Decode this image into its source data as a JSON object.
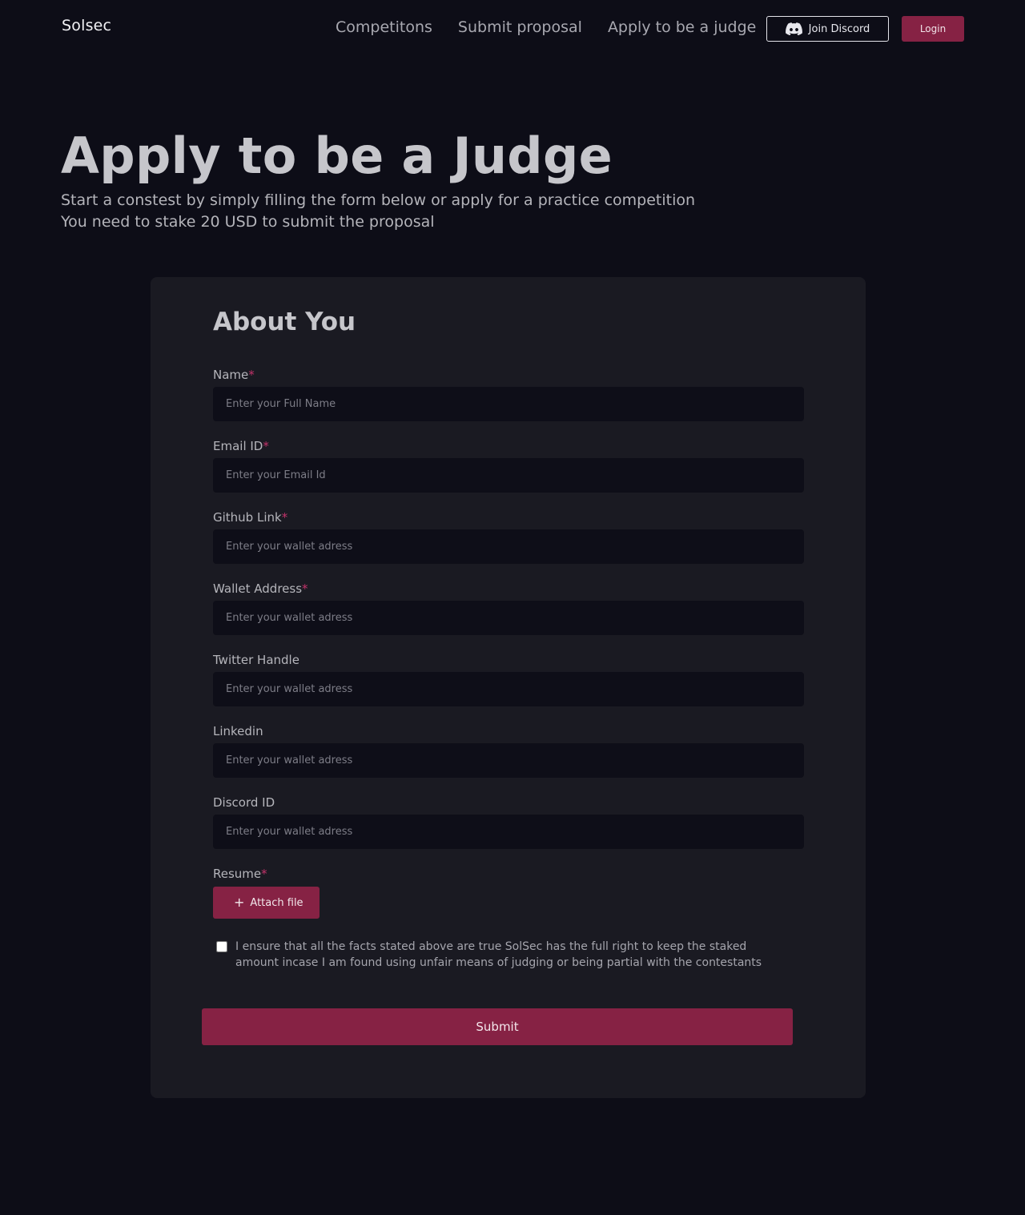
{
  "brand": {
    "logo": "Solsec"
  },
  "nav": {
    "links": [
      "Competitons",
      "Submit proposal",
      "Apply to be a judge"
    ],
    "discord_label": "Join Discord",
    "login_label": "Login"
  },
  "hero": {
    "title": "Apply to be a Judge",
    "subtitle_line1": "Start a constest by simply filling the form below or apply for a practice competition",
    "subtitle_line2": "You need to stake 20 USD to submit the proposal"
  },
  "form": {
    "section_title": "About You",
    "required_marker": "*",
    "fields": [
      {
        "label": "Name",
        "placeholder": "Enter your Full Name",
        "required": true
      },
      {
        "label": "Email ID",
        "placeholder": "Enter your Email Id",
        "required": true
      },
      {
        "label": "Github Link",
        "placeholder": "Enter your wallet adress",
        "required": true
      },
      {
        "label": "Wallet Address",
        "placeholder": "Enter your wallet adress",
        "required": true
      },
      {
        "label": "Twitter Handle",
        "placeholder": "Enter your wallet adress",
        "required": false
      },
      {
        "label": "Linkedin",
        "placeholder": "Enter your wallet adress",
        "required": false
      },
      {
        "label": "Discord ID",
        "placeholder": "Enter your wallet adress",
        "required": false
      }
    ],
    "resume": {
      "label": "Resume",
      "required": true,
      "attach_label": "Attach file",
      "attach_icon": "plus-icon"
    },
    "consent_text": "I ensure that all the facts stated above are true SolSec has the full right to keep the staked amount incase I am found using unfair means of judging or being partial with the contestants",
    "consent_checked": false,
    "submit_label": "Submit"
  },
  "colors": {
    "background": "#0d0d17",
    "card": "#1a1a22",
    "input": "#0e0e18",
    "accent": "#862244",
    "required": "#c2336a"
  }
}
